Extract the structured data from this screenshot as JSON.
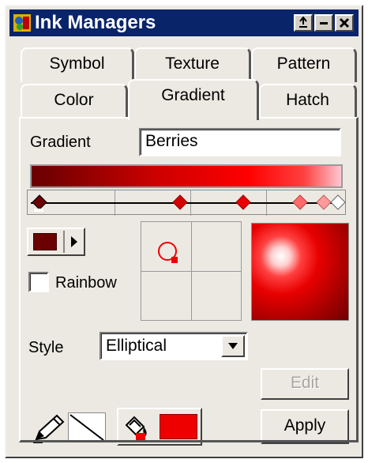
{
  "window": {
    "title": "Ink Managers"
  },
  "tabs": [
    {
      "label": "Symbol"
    },
    {
      "label": "Texture"
    },
    {
      "label": "Pattern"
    },
    {
      "label": "Color"
    },
    {
      "label": "Gradient"
    },
    {
      "label": "Hatch"
    }
  ],
  "active_tab": "Gradient",
  "gradient": {
    "label": "Gradient",
    "name": "Berries",
    "ramp_colors": [
      "#6a0000",
      "#cc0000",
      "#ff0000",
      "#ffc8d0"
    ],
    "selected_color": "#6a0000"
  },
  "rainbow": {
    "label": "Rainbow",
    "checked": false
  },
  "style": {
    "label": "Style",
    "value": "Elliptical"
  },
  "buttons": {
    "edit": "Edit",
    "apply": "Apply"
  },
  "colors": {
    "accent_red": "#ee0000",
    "title_bar": "#0a246a"
  },
  "icons": {
    "app": "app-icon",
    "pen": "pen-tool-icon",
    "line": "line-sample-icon",
    "paint_bucket": "paint-bucket-icon",
    "origin": "gradient-origin-icon"
  }
}
